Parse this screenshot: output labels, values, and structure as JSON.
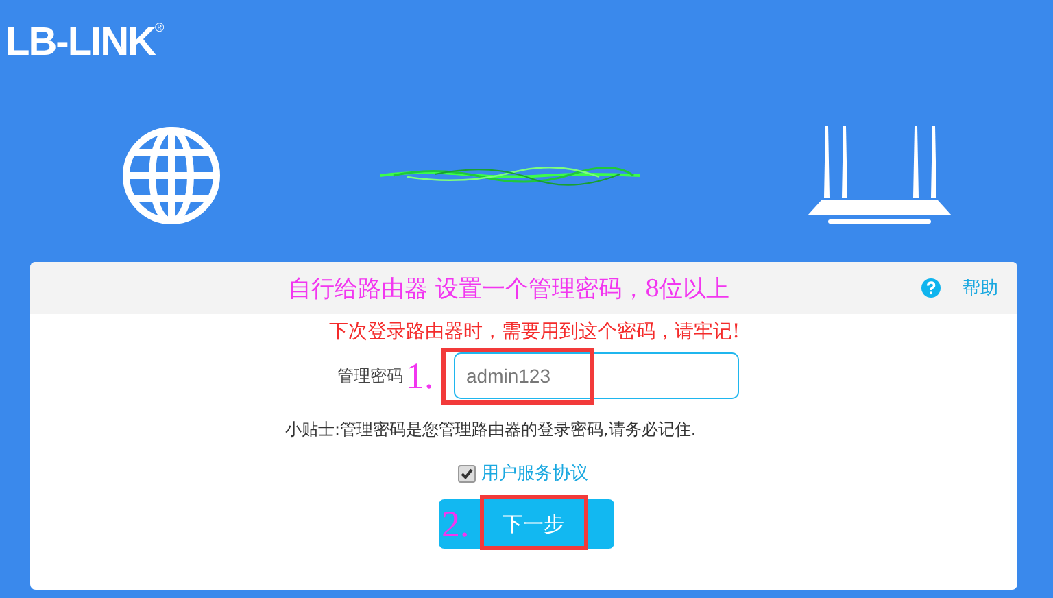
{
  "brand": {
    "logo_text": "LB-LINK",
    "registered_mark": "®"
  },
  "card": {
    "title": "自行给路由器  设置一个管理密码，8位以上",
    "help": "帮助",
    "warning": "下次登录路由器时，需要用到这个密码，请牢记!",
    "password_field": {
      "label": "管理密码",
      "annotation": "1.",
      "value": "admin123"
    },
    "tip": "小贴士:管理密码是您管理路由器的登录密码,请务必记住.",
    "agreement": {
      "label": "用户服务协议",
      "checked": true
    },
    "next_button": {
      "label": "下一步",
      "annotation": "2."
    }
  }
}
